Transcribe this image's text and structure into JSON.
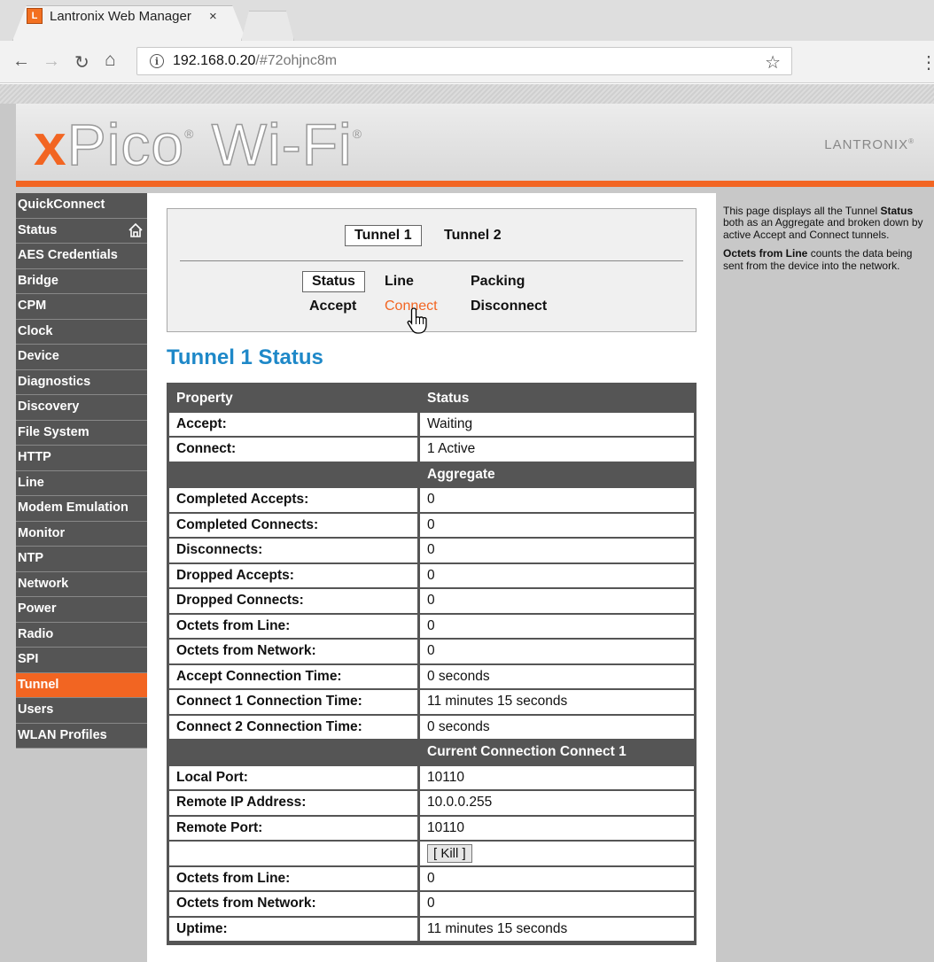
{
  "browser": {
    "tab_title": "Lantronix Web Manager",
    "tab_close": "×",
    "favicon": "L",
    "url_host": "192.168.0.20",
    "url_path": "/#72ohjnc8m"
  },
  "banner": {
    "logo_x": "x",
    "logo_rest": "Pico",
    "logo_reg": "®",
    "logo_wifi": " Wi-Fi",
    "logo_reg2": "®",
    "brand": "LANTRONIX",
    "brand_reg": "®"
  },
  "sidebar": {
    "items": [
      {
        "label": "QuickConnect"
      },
      {
        "label": "Status"
      },
      {
        "label": "AES Credentials"
      },
      {
        "label": "Bridge"
      },
      {
        "label": "CPM"
      },
      {
        "label": "Clock"
      },
      {
        "label": "Device"
      },
      {
        "label": "Diagnostics"
      },
      {
        "label": "Discovery"
      },
      {
        "label": "File System"
      },
      {
        "label": "HTTP"
      },
      {
        "label": "Line"
      },
      {
        "label": "Modem Emulation"
      },
      {
        "label": "Monitor"
      },
      {
        "label": "NTP"
      },
      {
        "label": "Network"
      },
      {
        "label": "Power"
      },
      {
        "label": "Radio"
      },
      {
        "label": "SPI"
      },
      {
        "label": "Tunnel"
      },
      {
        "label": "Users"
      },
      {
        "label": "WLAN Profiles"
      }
    ],
    "active": "Tunnel"
  },
  "subnav": {
    "tunnel_tabs": [
      "Tunnel 1",
      "Tunnel 2"
    ],
    "row1": [
      "Status",
      "Line",
      "Packing"
    ],
    "row2": [
      "Accept",
      "Connect",
      "Disconnect"
    ]
  },
  "title": "Tunnel 1 Status",
  "table": {
    "header": {
      "property": "Status",
      "label": "Property"
    },
    "rows_top": [
      {
        "prop": "Accept:",
        "val": "Waiting"
      },
      {
        "prop": "Connect:",
        "val": "1 Active"
      }
    ],
    "section_aggregate": "Aggregate",
    "rows_aggregate": [
      {
        "prop": "Completed Accepts:",
        "val": "0"
      },
      {
        "prop": "Completed Connects:",
        "val": "0"
      },
      {
        "prop": "Disconnects:",
        "val": "0"
      },
      {
        "prop": "Dropped Accepts:",
        "val": "0"
      },
      {
        "prop": "Dropped Connects:",
        "val": "0"
      },
      {
        "prop": "Octets from Line:",
        "val": "0"
      },
      {
        "prop": "Octets from Network:",
        "val": "0"
      },
      {
        "prop": "Accept Connection Time:",
        "val": "0 seconds"
      },
      {
        "prop": "Connect 1 Connection Time:",
        "val": "11 minutes 15 seconds"
      },
      {
        "prop": "Connect 2 Connection Time:",
        "val": "0 seconds"
      }
    ],
    "section_current": "Current Connection Connect 1",
    "rows_current": [
      {
        "prop": "Local Port:",
        "val": "10110"
      },
      {
        "prop": "Remote IP Address:",
        "val": "10.0.0.255"
      },
      {
        "prop": "Remote Port:",
        "val": "10110"
      }
    ],
    "kill_label": "[ Kill ]",
    "rows_after": [
      {
        "prop": "Octets from Line:",
        "val": "0"
      },
      {
        "prop": "Octets from Network:",
        "val": "0"
      },
      {
        "prop": "Uptime:",
        "val": "11 minutes 15 seconds"
      }
    ]
  },
  "help": {
    "p1_a": "This page displays all the Tunnel ",
    "p1_b": "Status",
    "p1_c": " both as an Aggregate and broken down by active Accept and Connect tunnels.",
    "p2_a": "Octets from Line",
    "p2_b": " counts the data being sent from the device into the network."
  },
  "colors": {
    "accent": "#f26522",
    "title": "#1e88c8",
    "sidebar": "#555555"
  }
}
